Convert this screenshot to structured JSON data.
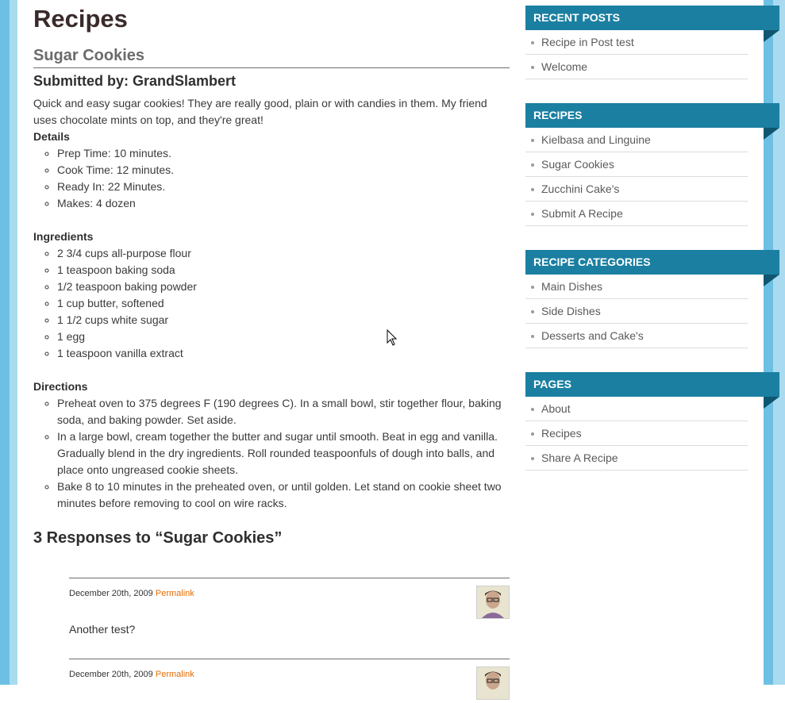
{
  "main": {
    "page_title": "Recipes",
    "post_title": "Sugar Cookies",
    "submitted_by": "Submitted by: GrandSlambert",
    "intro": "Quick and easy sugar cookies! They are really good, plain or with candies in them. My friend uses chocolate mints on top, and they're great!",
    "details_heading": "Details",
    "details": [
      "Prep Time: 10 minutes.",
      "Cook Time: 12 minutes.",
      "Ready In: 22 Minutes.",
      "Makes: 4 dozen"
    ],
    "ingredients_heading": "Ingredients",
    "ingredients": [
      "2 3/4 cups all-purpose flour",
      "1 teaspoon baking soda",
      "1/2 teaspoon baking powder",
      "1 cup butter, softened",
      "1 1/2 cups white sugar",
      "1 egg",
      "1 teaspoon vanilla extract"
    ],
    "directions_heading": "Directions",
    "directions": [
      "Preheat oven to 375 degrees F (190 degrees C). In a small bowl, stir together flour, baking soda, and baking powder. Set aside.",
      "In a large bowl, cream together the butter and sugar until smooth. Beat in egg and vanilla. Gradually blend in the dry ingredients. Roll rounded teaspoonfuls of dough into balls, and place onto ungreased cookie sheets.",
      "Bake 8 to 10 minutes in the preheated oven, or until golden. Let stand on cookie sheet two minutes before removing to cool on wire racks."
    ],
    "responses_heading": "3 Responses to “Sugar Cookies”",
    "comments": [
      {
        "date": "December 20th, 2009",
        "permalink": "Permalink",
        "text": "Another test?"
      },
      {
        "date": "December 20th, 2009",
        "permalink": "Permalink",
        "text": ""
      }
    ]
  },
  "sidebar": {
    "recent_posts": {
      "title": "Recent Posts",
      "items": [
        "Recipe in Post test",
        "Welcome"
      ]
    },
    "recipes": {
      "title": "Recipes",
      "items": [
        "Kielbasa and Linguine",
        "Sugar Cookies",
        "Zucchini Cake's",
        "Submit A Recipe"
      ]
    },
    "recipe_categories": {
      "title": "Recipe Categories",
      "items": [
        "Main Dishes",
        "Side Dishes",
        "Desserts and Cake's"
      ]
    },
    "pages": {
      "title": "Pages",
      "items": [
        "About",
        "Recipes",
        "Share A Recipe"
      ]
    }
  },
  "colors": {
    "accent": "#1b7fa1",
    "link": "#e66b00",
    "stripe": "#6dc0e4"
  }
}
